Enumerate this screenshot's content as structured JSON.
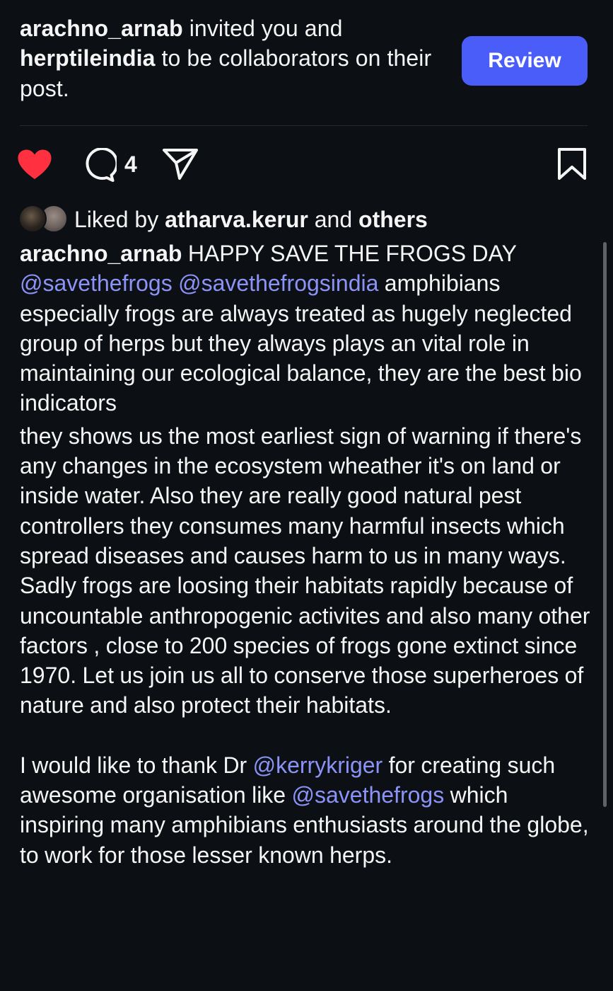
{
  "notification": {
    "user1": "arachno_arnab",
    "text1": " invited you and",
    "user2": "herptileindia",
    "text2": " to be collaborators on their post.",
    "review_label": "Review"
  },
  "actions": {
    "liked": true,
    "comment_count": "4",
    "icons": [
      "heart-filled-icon",
      "comment-icon",
      "share-icon",
      "bookmark-icon"
    ],
    "like_color": "#ff3040"
  },
  "likes": {
    "prefix": "Liked by ",
    "user": "atharva.kerur",
    "middle": " and ",
    "others": "others"
  },
  "caption": {
    "author": "arachno_arnab",
    "p1": {
      "t1": " HAPPY SAVE THE FROGS DAY ",
      "m1": "@savethefrogs",
      "s1": " ",
      "m2": "@savethefrogsindia",
      "t2": " amphibians especially frogs are always treated as hugely neglected group of herps but they always plays an vital role in maintaining our ecological balance, they are the best bio indicators"
    },
    "p2": "they shows us the most earliest sign of warning if there's any changes in the ecosystem wheather it's on land or inside water. Also they are really good natural pest controllers they consumes many harmful insects which spread diseases and causes harm to us in many ways. Sadly frogs are loosing their habitats rapidly because of uncountable anthropogenic activites and also many other factors , close to 200 species of frogs gone extinct since 1970. Let us join us all to conserve those superheroes of nature and also protect their habitats.",
    "p3": {
      "t1": "I would like to thank Dr ",
      "m1": "@kerrykriger",
      "t2": " for creating such awesome organisation like ",
      "m2": "@savethefrogs",
      "t3": " which inspiring many amphibians enthusiasts around the globe, to work for those lesser known herps."
    }
  },
  "colors": {
    "background": "#0c1014",
    "accent_button": "#4a5df9",
    "mention": "#8c93f7"
  }
}
